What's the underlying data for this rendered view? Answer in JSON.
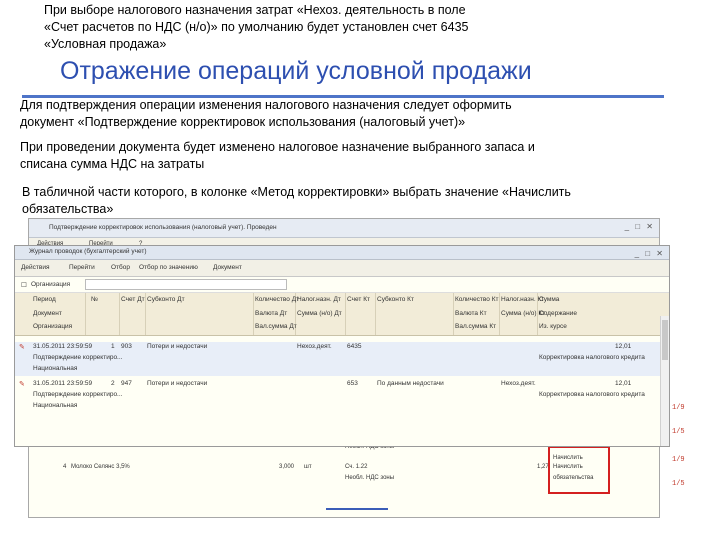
{
  "intro": {
    "line1": "При выборе налогового назначения затрат «Нехоз. деятельность в поле",
    "line2": "«Счет расчетов по НДС (н/о)» по умолчанию будет установлен счет 6435",
    "line3": "«Условная продажа»"
  },
  "title": "Отражение операций условной продажи",
  "paragraphs": {
    "p1_line1": "Для подтверждения операции изменения налогового назначения следует оформить",
    "p1_line2": "документ «Подтверждение корректировок использования (налоговый учет)»",
    "p2_line1": "При проведении документа будет изменено налоговое назначение выбранного запаса и",
    "p2_line2": "списана сумма НДС на затраты",
    "p3_line1": "В табличной части которого, в колонке «Метод корректировки» выбрать значение «Начислить",
    "p3_line2": "обязательства»"
  },
  "doc_window": {
    "title": "Подтверждение корректировок использования (налоговый учет). Проведен",
    "toolbar": [
      "Действия",
      "Перейти",
      "?"
    ],
    "rows": [
      {
        "num": "4",
        "item": "Молоко Селянс 3,5%",
        "qty": "3,000",
        "unit": "шт",
        "acc": "Сч. 1.22",
        "nds": "Необл. НДС зоны",
        "val": "1,27",
        "method": "Начислить",
        "method2": "обязательства"
      },
      {
        "num": "",
        "item": "",
        "qty": "",
        "unit": "",
        "acc": "Сч. 1.22",
        "nds": "Необл. НДС зоны",
        "val": "",
        "method": "Начислить",
        "method2": "обязательства"
      }
    ],
    "side_marks": [
      "1/9",
      "1/5",
      "1/9",
      "1/5"
    ]
  },
  "journal": {
    "title": "Журнал проводок (бухгалтерский учет)",
    "toolbar": [
      "Действия",
      "Перейти",
      "Отбор",
      "Отбор по значению",
      "Документ"
    ],
    "filter_label": "Организация",
    "filter_value": "",
    "headers_row1": [
      "Период",
      "№",
      "Счет Дт",
      "Субконто Дт",
      "Количество Дт",
      "Налог.назн. Дт",
      "Счет Кт",
      "Субконто Кт",
      "Количество Кт",
      "Налог.назн. Кт",
      "Сумма"
    ],
    "headers_row2": [
      "Документ",
      "",
      "",
      "",
      "Валюта Дт",
      "Сумма (н/о) Дт",
      "",
      "",
      "Валюта Кт",
      "Сумма (н/о) Кт",
      "Содержание"
    ],
    "headers_row3": [
      "Организация",
      "",
      "",
      "",
      "Вал.сумма Дт",
      "",
      "",
      "",
      "Вал.сумма Кт",
      "",
      "Из. курсе"
    ],
    "records": [
      {
        "date": "31.05.2011 23:59:59",
        "num": "1",
        "acc_dt": "903",
        "sub_dt": "Потери и недостачи",
        "nazn_dt": "Нехоз.деят.",
        "acc_kt": "6435",
        "amount": "12,01",
        "doc": "Подтверждение корректиро...",
        "content": "Корректировка налогового кредита",
        "org": "Национальная"
      },
      {
        "date": "31.05.2011 23:59:59",
        "num": "2",
        "acc_dt": "947",
        "sub_dt": "Потери и недостачи",
        "acc_kt": "653",
        "sub_kt": "По данным недостачи",
        "nazn_kt": "Нехоз.деят.",
        "amount": "12,01",
        "doc": "Подтверждение корректиро...",
        "content": "Корректировка налогового кредита",
        "org": "Национальная"
      }
    ]
  }
}
